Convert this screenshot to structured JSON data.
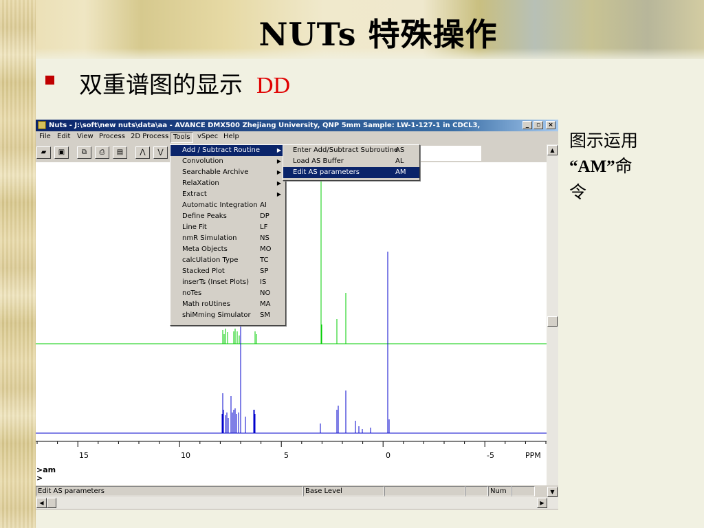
{
  "slide": {
    "title": "NUTs 特殊操作",
    "subtitle": "双重谱图的显示",
    "subtitle_accent": "DD",
    "note_line1": "图示运用",
    "note_line2": "“AM”",
    "note_line2_suffix": "命",
    "note_line3": "令"
  },
  "window": {
    "title": "Nuts - J:\\soft\\new nuts\\data\\aa - AVANCE DMX500 Zhejiang University, QNP 5mm Sample: LW-1-127-1 in CDCL3,",
    "minimize": "_",
    "restore": "▫",
    "close": "×"
  },
  "menubar": [
    "File",
    "Edit",
    "View",
    "Process",
    "2D Process",
    "Tools",
    "vSpec",
    "Help"
  ],
  "tools_menu": [
    {
      "label": "Add / Subtract Routine",
      "key": "",
      "submenu": true,
      "selected": true
    },
    {
      "label": "Convolution",
      "key": "",
      "submenu": true
    },
    {
      "label": "Searchable Archive",
      "key": "",
      "submenu": true
    },
    {
      "label": "RelaXation",
      "key": "",
      "submenu": true
    },
    {
      "label": "Extract",
      "key": "",
      "submenu": true
    },
    {
      "label": "Automatic Integration",
      "key": "AI"
    },
    {
      "label": "Define Peaks",
      "key": "DP"
    },
    {
      "label": "Line Fit",
      "key": "LF"
    },
    {
      "label": "nmR Simulation",
      "key": "NS"
    },
    {
      "label": "Meta Objects",
      "key": "MO"
    },
    {
      "label": "calcUlation Type",
      "key": "TC"
    },
    {
      "label": "Stacked Plot",
      "key": "SP"
    },
    {
      "label": "inserTs (Inset Plots)",
      "key": "IS"
    },
    {
      "label": "noTes",
      "key": "NO"
    },
    {
      "label": "Math roUtines",
      "key": "MA"
    },
    {
      "label": "shiMming Simulator",
      "key": "SM"
    }
  ],
  "add_subtract_submenu": [
    {
      "label": "Enter Add/Subtract Subroutine",
      "key": "AS"
    },
    {
      "label": "Load AS Buffer",
      "key": "AL"
    },
    {
      "label": "Edit AS parameters",
      "key": "AM",
      "selected": true
    }
  ],
  "axis": {
    "ticks": [
      "15",
      "10",
      "5",
      "0",
      "-5"
    ],
    "unit": "PPM"
  },
  "command": {
    "line1": ">am",
    "line2": ">"
  },
  "status": {
    "message": "Edit AS parameters",
    "level": "Base Level",
    "num": "Num"
  },
  "colors": {
    "green_trace": "#00cc00",
    "blue_trace": "#0000cc",
    "selection": "#0a246a",
    "accent_red": "#e00000"
  }
}
